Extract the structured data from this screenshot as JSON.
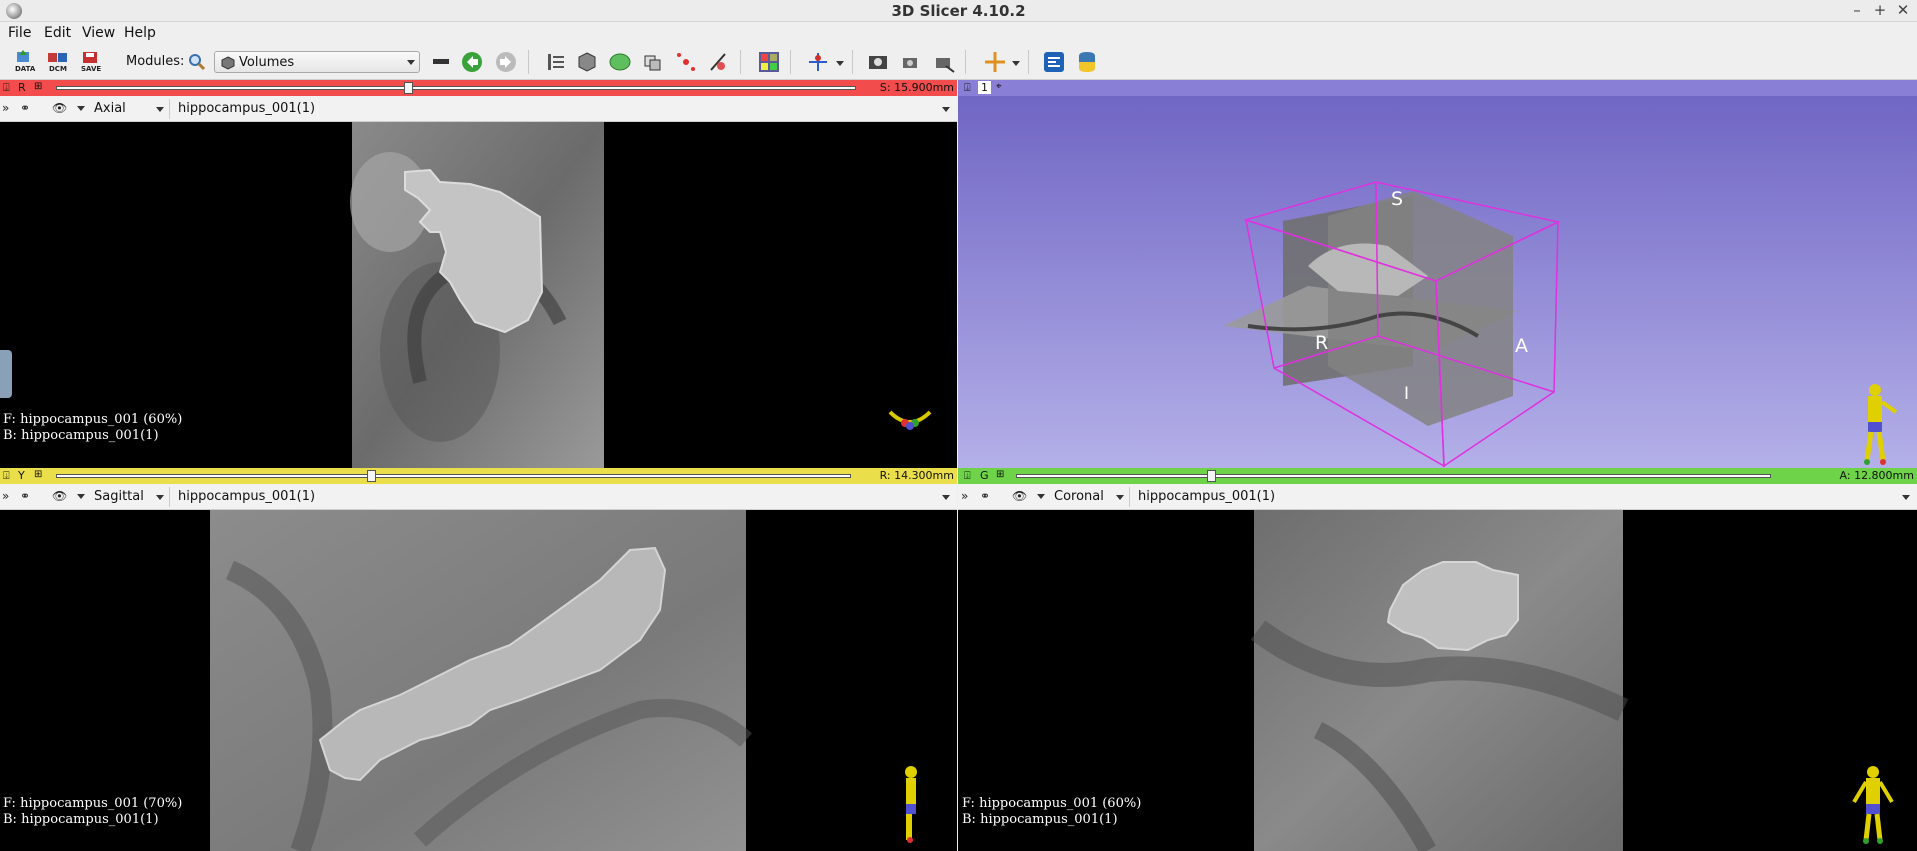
{
  "window": {
    "title": "3D Slicer 4.10.2",
    "controls": [
      "–",
      "+",
      "✕"
    ]
  },
  "menu": [
    "File",
    "Edit",
    "View",
    "Help"
  ],
  "toolbar": {
    "data_label": "DATA",
    "dcm_label": "DCM",
    "save_label": "SAVE",
    "modules_label": "Modules:",
    "module_selected": "Volumes"
  },
  "red_view": {
    "letter": "R",
    "offset": "S: 15.900mm",
    "slider_fraction": 0.44,
    "orientation": "Axial",
    "volume": "hippocampus_001(1)",
    "fg": "F: hippocampus_001 (60%)",
    "bg": "B: hippocampus_001(1)",
    "color": "#f24c4c"
  },
  "view3d": {
    "number": "1",
    "labels": {
      "s": "S",
      "r": "R",
      "a": "A",
      "i": "I"
    },
    "color": "#8a7fd6"
  },
  "yellow_view": {
    "letter": "Y",
    "offset": "R: 14.300mm",
    "slider_fraction": 0.4,
    "orientation": "Sagittal",
    "volume": "hippocampus_001(1)",
    "fg": "F: hippocampus_001 (70%)",
    "bg": "B: hippocampus_001(1)",
    "color": "#eadf4a"
  },
  "green_view": {
    "letter": "G",
    "offset": "A: 12.800mm",
    "slider_fraction": 0.24,
    "orientation": "Coronal",
    "volume": "hippocampus_001(1)",
    "fg": "F: hippocampus_001 (60%)",
    "bg": "B: hippocampus_001(1)",
    "color": "#6fd34a"
  }
}
